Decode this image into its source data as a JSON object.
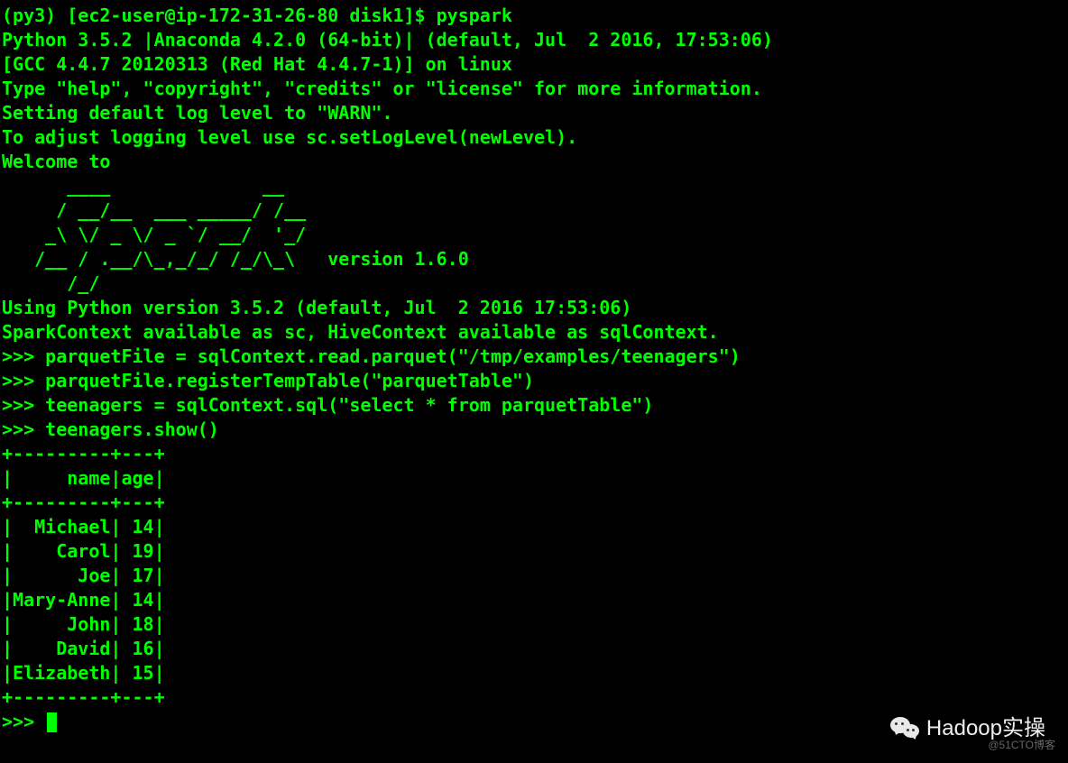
{
  "terminal": {
    "lines": [
      "(py3) [ec2-user@ip-172-31-26-80 disk1]$ pyspark",
      "Python 3.5.2 |Anaconda 4.2.0 (64-bit)| (default, Jul  2 2016, 17:53:06)",
      "[GCC 4.4.7 20120313 (Red Hat 4.4.7-1)] on linux",
      "Type \"help\", \"copyright\", \"credits\" or \"license\" for more information.",
      "Setting default log level to \"WARN\".",
      "To adjust logging level use sc.setLogLevel(newLevel).",
      "Welcome to",
      "      ____              __",
      "     / __/__  ___ _____/ /__",
      "    _\\ \\/ _ \\/ _ `/ __/  '_/",
      "   /__ / .__/\\_,_/_/ /_/\\_\\   version 1.6.0",
      "      /_/",
      "",
      "Using Python version 3.5.2 (default, Jul  2 2016 17:53:06)",
      "SparkContext available as sc, HiveContext available as sqlContext.",
      ">>> parquetFile = sqlContext.read.parquet(\"/tmp/examples/teenagers\")",
      ">>> parquetFile.registerTempTable(\"parquetTable\")",
      ">>> teenagers = sqlContext.sql(\"select * from parquetTable\")",
      ">>> teenagers.show()",
      "+---------+---+",
      "|     name|age|",
      "+---------+---+",
      "|  Michael| 14|",
      "|    Carol| 19|",
      "|      Joe| 17|",
      "|Mary-Anne| 14|",
      "|     John| 18|",
      "|    David| 16|",
      "|Elizabeth| 15|",
      "+---------+---+",
      "",
      ">>> "
    ]
  },
  "watermark": {
    "text": "Hadoop实操"
  },
  "copyright": "@51CTO博客",
  "table_data": {
    "columns": [
      "name",
      "age"
    ],
    "rows": [
      {
        "name": "Michael",
        "age": 14
      },
      {
        "name": "Carol",
        "age": 19
      },
      {
        "name": "Joe",
        "age": 17
      },
      {
        "name": "Mary-Anne",
        "age": 14
      },
      {
        "name": "John",
        "age": 18
      },
      {
        "name": "David",
        "age": 16
      },
      {
        "name": "Elizabeth",
        "age": 15
      }
    ]
  }
}
